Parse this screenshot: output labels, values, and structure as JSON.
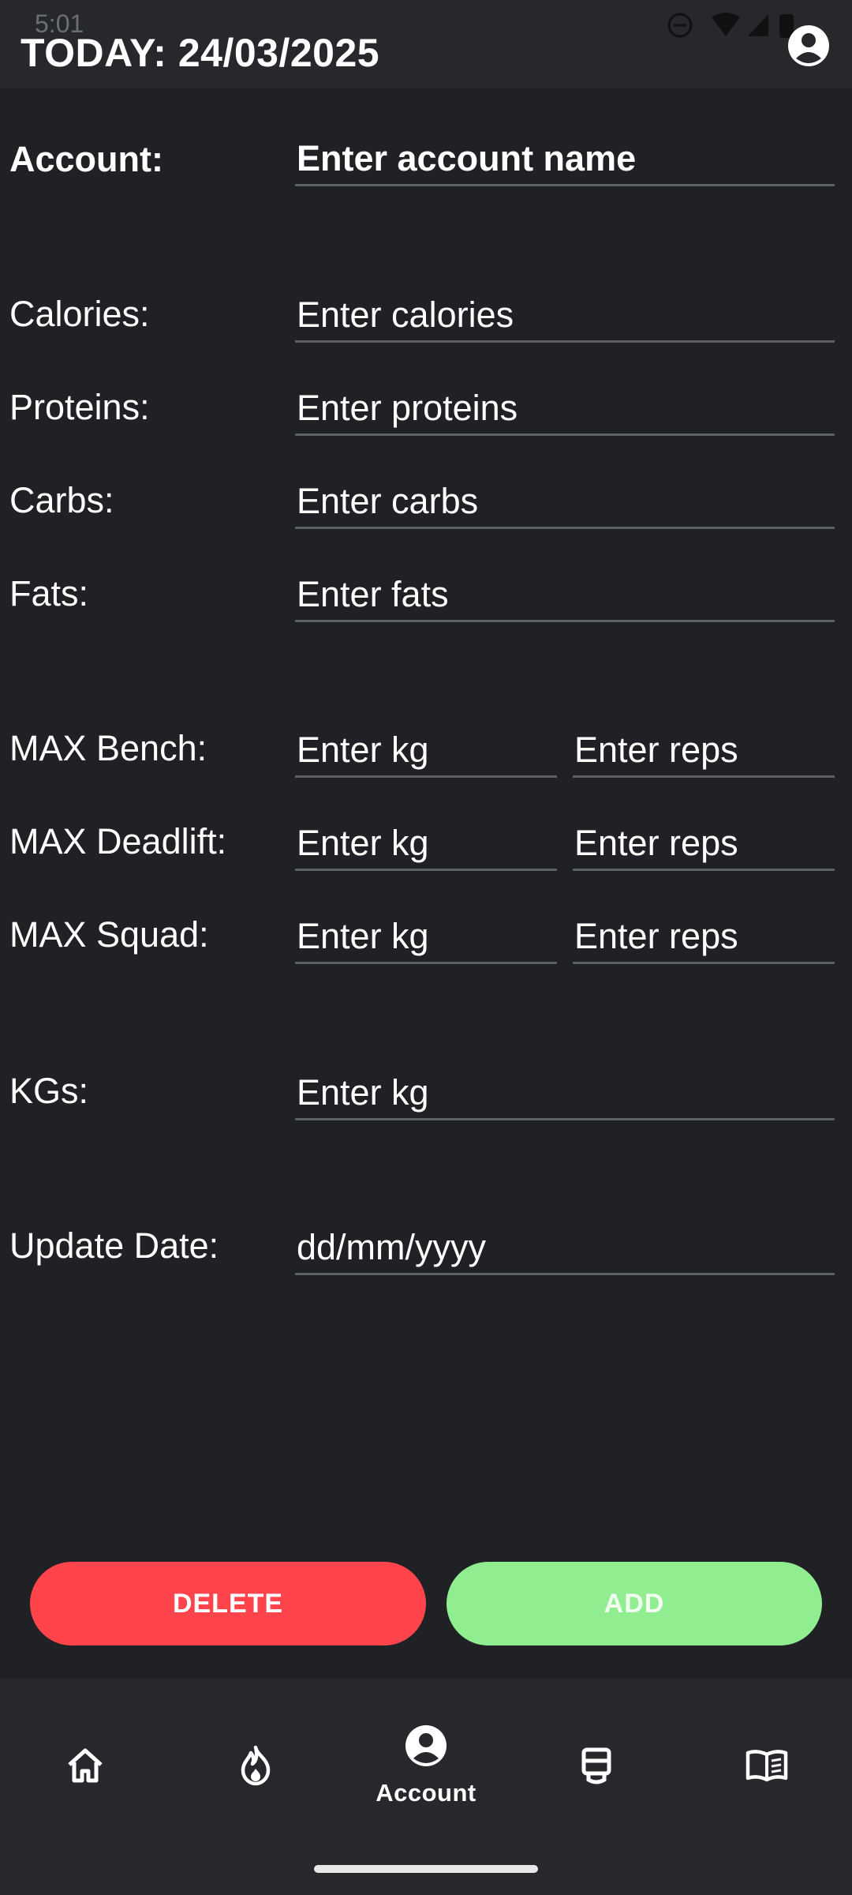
{
  "status": {
    "time": "5:01"
  },
  "header": {
    "title": "TODAY: 24/03/2025"
  },
  "form": {
    "account": {
      "label": "Account:",
      "placeholder": "Enter account name"
    },
    "calories": {
      "label": "Calories:",
      "placeholder": "Enter calories"
    },
    "proteins": {
      "label": "Proteins:",
      "placeholder": "Enter proteins"
    },
    "carbs": {
      "label": "Carbs:",
      "placeholder": "Enter carbs"
    },
    "fats": {
      "label": "Fats:",
      "placeholder": "Enter fats"
    },
    "bench": {
      "label": "MAX Bench:",
      "kg_placeholder": "Enter kg",
      "reps_placeholder": "Enter reps"
    },
    "deadlift": {
      "label": "MAX Deadlift:",
      "kg_placeholder": "Enter kg",
      "reps_placeholder": "Enter reps"
    },
    "squad": {
      "label": "MAX Squad:",
      "kg_placeholder": "Enter kg",
      "reps_placeholder": "Enter reps"
    },
    "kgs": {
      "label": "KGs:",
      "placeholder": "Enter kg"
    },
    "update_date": {
      "label": "Update Date:",
      "placeholder": "dd/mm/yyyy"
    }
  },
  "buttons": {
    "delete": "DELETE",
    "add": "ADD"
  },
  "nav": {
    "items": [
      {
        "icon": "home-icon",
        "label": ""
      },
      {
        "icon": "fire-icon",
        "label": ""
      },
      {
        "icon": "account-icon",
        "label": "Account"
      },
      {
        "icon": "drink-icon",
        "label": ""
      },
      {
        "icon": "book-icon",
        "label": ""
      }
    ]
  },
  "colors": {
    "delete": "#ff444b",
    "add": "#90ee90",
    "background": "#1f2124",
    "bar": "#26282c"
  }
}
